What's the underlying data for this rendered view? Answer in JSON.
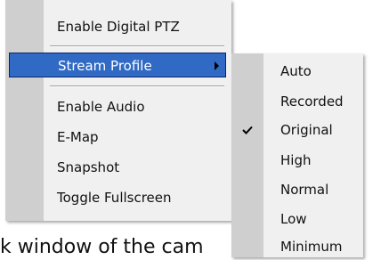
{
  "background": {
    "text": "k window of the cam"
  },
  "context_menu": {
    "items": [
      {
        "label": "Enable Digital PTZ"
      },
      {
        "label": "Stream Profile",
        "has_submenu": true,
        "highlighted": true
      },
      {
        "label": "Enable Audio"
      },
      {
        "label": "E-Map"
      },
      {
        "label": "Snapshot"
      },
      {
        "label": "Toggle Fullscreen"
      }
    ]
  },
  "stream_profile_submenu": {
    "items": [
      {
        "label": "Auto"
      },
      {
        "label": "Recorded"
      },
      {
        "label": "Original",
        "checked": true
      },
      {
        "label": "High"
      },
      {
        "label": "Normal"
      },
      {
        "label": "Low"
      },
      {
        "label": "Minimum"
      }
    ]
  },
  "colors": {
    "highlight": "#316ac5",
    "menu_bg": "#f0f0f0",
    "gutter": "#cfcfcf"
  }
}
